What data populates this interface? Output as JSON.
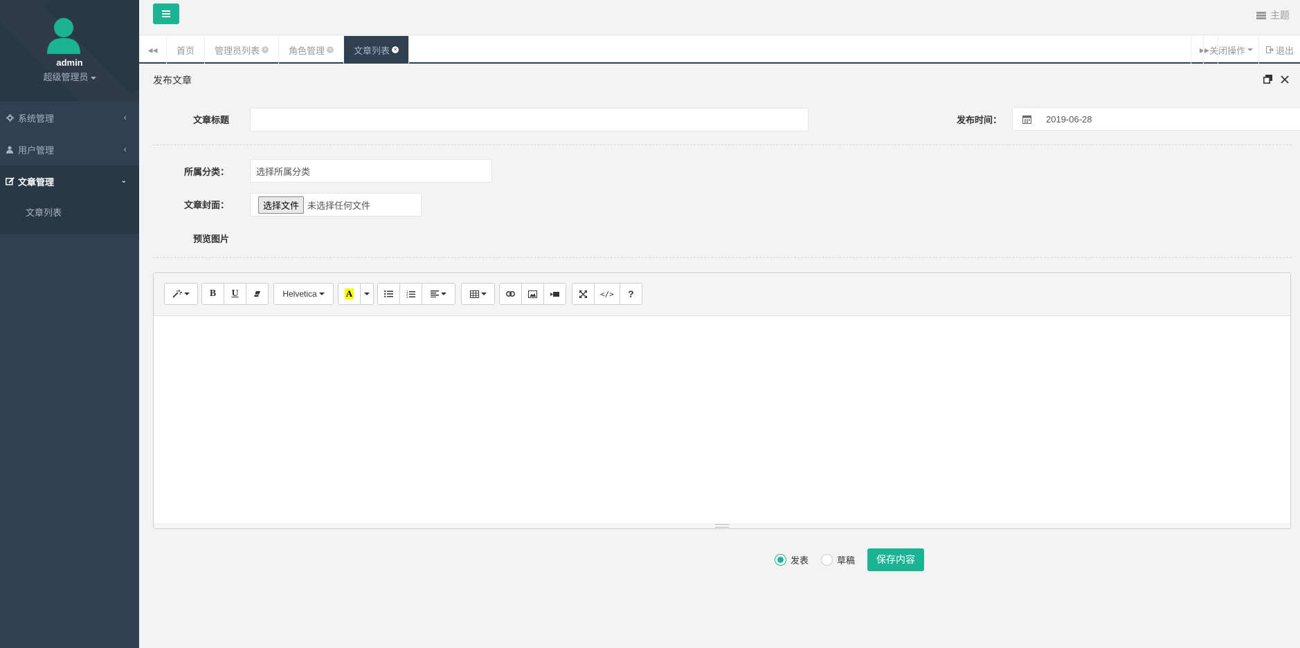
{
  "sidebar": {
    "user_name": "admin",
    "user_role": "超级管理员",
    "items": [
      {
        "label": "系统管理",
        "icon": "gear-icon"
      },
      {
        "label": "用户管理",
        "icon": "user-icon"
      },
      {
        "label": "文章管理",
        "icon": "edit-icon"
      }
    ],
    "subitem": "文章列表"
  },
  "topbar": {
    "theme_label": "主题"
  },
  "tabs": [
    {
      "label": "首页"
    },
    {
      "label": "管理员列表"
    },
    {
      "label": "角色管理"
    },
    {
      "label": "文章列表"
    }
  ],
  "tabbar": {
    "close_ops": "关闭操作",
    "logout": "退出"
  },
  "panel": {
    "title": "发布文章"
  },
  "form": {
    "title_label": "文章标题",
    "title_value": "",
    "publish_time_label": "发布时间：",
    "publish_time_value": "2019-06-28",
    "category_label": "所属分类：",
    "category_value": "选择所属分类",
    "cover_label": "文章封面：",
    "file_button": "选择文件",
    "file_status": "未选择任何文件",
    "preview_label": "预览图片"
  },
  "editor": {
    "font_name": "Helvetica"
  },
  "actions": {
    "publish_label": "发表",
    "draft_label": "草稿",
    "save_label": "保存内容",
    "selected": "发表"
  },
  "colors": {
    "accent": "#1ab394",
    "sidebar_bg": "#2f4050"
  }
}
